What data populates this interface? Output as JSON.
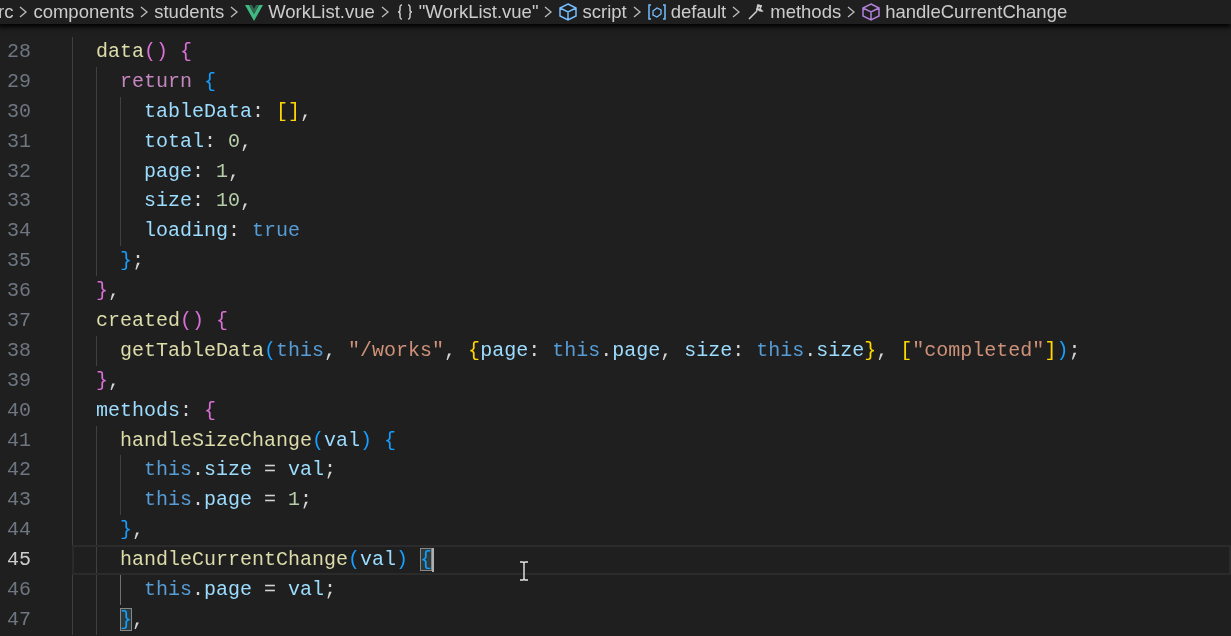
{
  "breadcrumbs": [
    {
      "label": "rc",
      "kind": "folder"
    },
    {
      "label": "components",
      "kind": "folder"
    },
    {
      "label": "students",
      "kind": "folder"
    },
    {
      "label": "WorkList.vue",
      "kind": "vuefile"
    },
    {
      "label": "\"WorkList.vue\"",
      "kind": "object"
    },
    {
      "label": "script",
      "kind": "script"
    },
    {
      "label": "default",
      "kind": "module"
    },
    {
      "label": "methods",
      "kind": "property"
    },
    {
      "label": "handleCurrentChange",
      "kind": "method"
    }
  ],
  "lines": [
    {
      "number": "28",
      "current": false,
      "tokens": [
        {
          "text": "  data",
          "kind": "fn"
        },
        {
          "text": "()",
          "kind": "b2"
        },
        {
          "text": " {",
          "kind": "b2"
        }
      ]
    },
    {
      "number": "29",
      "current": false,
      "tokens": [
        {
          "text": "    return",
          "kind": "kw"
        },
        {
          "text": " {",
          "kind": "b3"
        }
      ]
    },
    {
      "number": "30",
      "current": false,
      "tokens": [
        {
          "text": "      tableData",
          "kind": "prop"
        },
        {
          "text": ": ",
          "kind": "plain"
        },
        {
          "text": "[]",
          "kind": "b1"
        },
        {
          "text": ",",
          "kind": "plain"
        }
      ]
    },
    {
      "number": "31",
      "current": false,
      "tokens": [
        {
          "text": "      total",
          "kind": "prop"
        },
        {
          "text": ": ",
          "kind": "plain"
        },
        {
          "text": "0",
          "kind": "num"
        },
        {
          "text": ",",
          "kind": "plain"
        }
      ]
    },
    {
      "number": "32",
      "current": false,
      "tokens": [
        {
          "text": "      page",
          "kind": "prop"
        },
        {
          "text": ": ",
          "kind": "plain"
        },
        {
          "text": "1",
          "kind": "num"
        },
        {
          "text": ",",
          "kind": "plain"
        }
      ]
    },
    {
      "number": "33",
      "current": false,
      "tokens": [
        {
          "text": "      size",
          "kind": "prop"
        },
        {
          "text": ": ",
          "kind": "plain"
        },
        {
          "text": "10",
          "kind": "num"
        },
        {
          "text": ",",
          "kind": "plain"
        }
      ]
    },
    {
      "number": "34",
      "current": false,
      "tokens": [
        {
          "text": "      loading",
          "kind": "prop"
        },
        {
          "text": ": ",
          "kind": "plain"
        },
        {
          "text": "true",
          "kind": "const"
        }
      ]
    },
    {
      "number": "35",
      "current": false,
      "tokens": [
        {
          "text": "    }",
          "kind": "b3"
        },
        {
          "text": ";",
          "kind": "plain"
        }
      ]
    },
    {
      "number": "36",
      "current": false,
      "tokens": [
        {
          "text": "  }",
          "kind": "b2"
        },
        {
          "text": ",",
          "kind": "plain"
        }
      ]
    },
    {
      "number": "37",
      "current": false,
      "tokens": [
        {
          "text": "  created",
          "kind": "fn"
        },
        {
          "text": "()",
          "kind": "b2"
        },
        {
          "text": " {",
          "kind": "b2"
        }
      ]
    },
    {
      "number": "38",
      "current": false,
      "tokens": [
        {
          "text": "    getTableData",
          "kind": "fn"
        },
        {
          "text": "(",
          "kind": "b3"
        },
        {
          "text": "this",
          "kind": "const"
        },
        {
          "text": ", ",
          "kind": "plain"
        },
        {
          "text": "\"/works\"",
          "kind": "str"
        },
        {
          "text": ", ",
          "kind": "plain"
        },
        {
          "text": "{",
          "kind": "b1"
        },
        {
          "text": "page",
          "kind": "prop"
        },
        {
          "text": ": ",
          "kind": "plain"
        },
        {
          "text": "this",
          "kind": "const"
        },
        {
          "text": ".",
          "kind": "plain"
        },
        {
          "text": "page",
          "kind": "prop"
        },
        {
          "text": ", ",
          "kind": "plain"
        },
        {
          "text": "size",
          "kind": "prop"
        },
        {
          "text": ": ",
          "kind": "plain"
        },
        {
          "text": "this",
          "kind": "const"
        },
        {
          "text": ".",
          "kind": "plain"
        },
        {
          "text": "size",
          "kind": "prop"
        },
        {
          "text": "}",
          "kind": "b1"
        },
        {
          "text": ", ",
          "kind": "plain"
        },
        {
          "text": "[",
          "kind": "b1"
        },
        {
          "text": "\"completed\"",
          "kind": "str"
        },
        {
          "text": "]",
          "kind": "b1"
        },
        {
          "text": ")",
          "kind": "b3"
        },
        {
          "text": ";",
          "kind": "plain"
        }
      ]
    },
    {
      "number": "39",
      "current": false,
      "tokens": [
        {
          "text": "  }",
          "kind": "b2"
        },
        {
          "text": ",",
          "kind": "plain"
        }
      ]
    },
    {
      "number": "40",
      "current": false,
      "tokens": [
        {
          "text": "  methods",
          "kind": "prop"
        },
        {
          "text": ": ",
          "kind": "plain"
        },
        {
          "text": "{",
          "kind": "b2"
        }
      ]
    },
    {
      "number": "41",
      "current": false,
      "tokens": [
        {
          "text": "    handleSizeChange",
          "kind": "fn"
        },
        {
          "text": "(",
          "kind": "b3"
        },
        {
          "text": "val",
          "kind": "prop"
        },
        {
          "text": ")",
          "kind": "b3"
        },
        {
          "text": " {",
          "kind": "b3"
        }
      ]
    },
    {
      "number": "42",
      "current": false,
      "tokens": [
        {
          "text": "      this",
          "kind": "const"
        },
        {
          "text": ".",
          "kind": "plain"
        },
        {
          "text": "size",
          "kind": "prop"
        },
        {
          "text": " = ",
          "kind": "plain"
        },
        {
          "text": "val",
          "kind": "prop"
        },
        {
          "text": ";",
          "kind": "plain"
        }
      ]
    },
    {
      "number": "43",
      "current": false,
      "tokens": [
        {
          "text": "      this",
          "kind": "const"
        },
        {
          "text": ".",
          "kind": "plain"
        },
        {
          "text": "page",
          "kind": "prop"
        },
        {
          "text": " = ",
          "kind": "plain"
        },
        {
          "text": "1",
          "kind": "num"
        },
        {
          "text": ";",
          "kind": "plain"
        }
      ]
    },
    {
      "number": "44",
      "current": false,
      "tokens": [
        {
          "text": "    }",
          "kind": "b3"
        },
        {
          "text": ",",
          "kind": "plain"
        }
      ]
    },
    {
      "number": "45",
      "current": true,
      "tokens": [
        {
          "text": "    handleCurrentChange",
          "kind": "fn"
        },
        {
          "text": "(",
          "kind": "b3"
        },
        {
          "text": "val",
          "kind": "prop"
        },
        {
          "text": ") ",
          "kind": "b3"
        },
        {
          "text": "{",
          "kind": "b3",
          "matched": true
        }
      ]
    },
    {
      "number": "46",
      "current": false,
      "tokens": [
        {
          "text": "      this",
          "kind": "const"
        },
        {
          "text": ".",
          "kind": "plain"
        },
        {
          "text": "page",
          "kind": "prop"
        },
        {
          "text": " = ",
          "kind": "plain"
        },
        {
          "text": "val",
          "kind": "prop"
        },
        {
          "text": ";",
          "kind": "plain"
        }
      ]
    },
    {
      "number": "47",
      "current": false,
      "tokens": [
        {
          "text": "    }",
          "kind": "b3",
          "matched": true
        },
        {
          "text": ",",
          "kind": "plain"
        }
      ]
    }
  ]
}
